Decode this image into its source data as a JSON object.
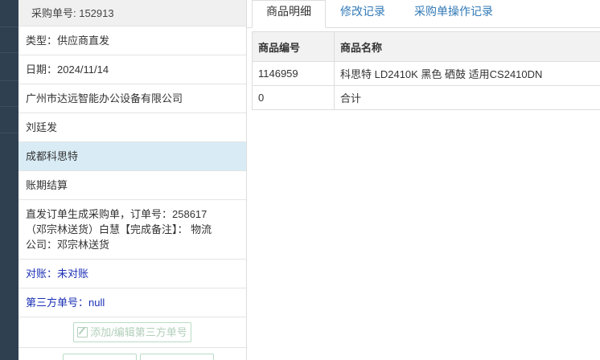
{
  "detail": {
    "order_no": "采购单号: 152913",
    "type": "类型：供应商直发",
    "date": "日期：2024/11/14",
    "company": "广州市达远智能办公设备有限公司",
    "person": "刘廷发",
    "supplier": "成都科思特",
    "settlement": "账期结算",
    "note_line1": "直发订单生成采购单，订单号：258617",
    "note_line2": "（邓宗林送货）白慧【完成备注】： 物流",
    "note_line3": "公司：邓宗林送货",
    "reconcile": "对账：未对账",
    "third_party_no": "第三方单号：null",
    "edit_third_party_button": "添加/编辑第三方单号"
  },
  "tabs": [
    {
      "label": "商品明细"
    },
    {
      "label": "修改记录"
    },
    {
      "label": "采购单操作记录"
    }
  ],
  "table": {
    "headers": [
      "商品编号",
      "商品名称"
    ],
    "rows": [
      [
        "1146959",
        "科思特 LD2410K 黑色 硒鼓 适用CS2410DN"
      ],
      [
        "0",
        "合计"
      ]
    ]
  }
}
